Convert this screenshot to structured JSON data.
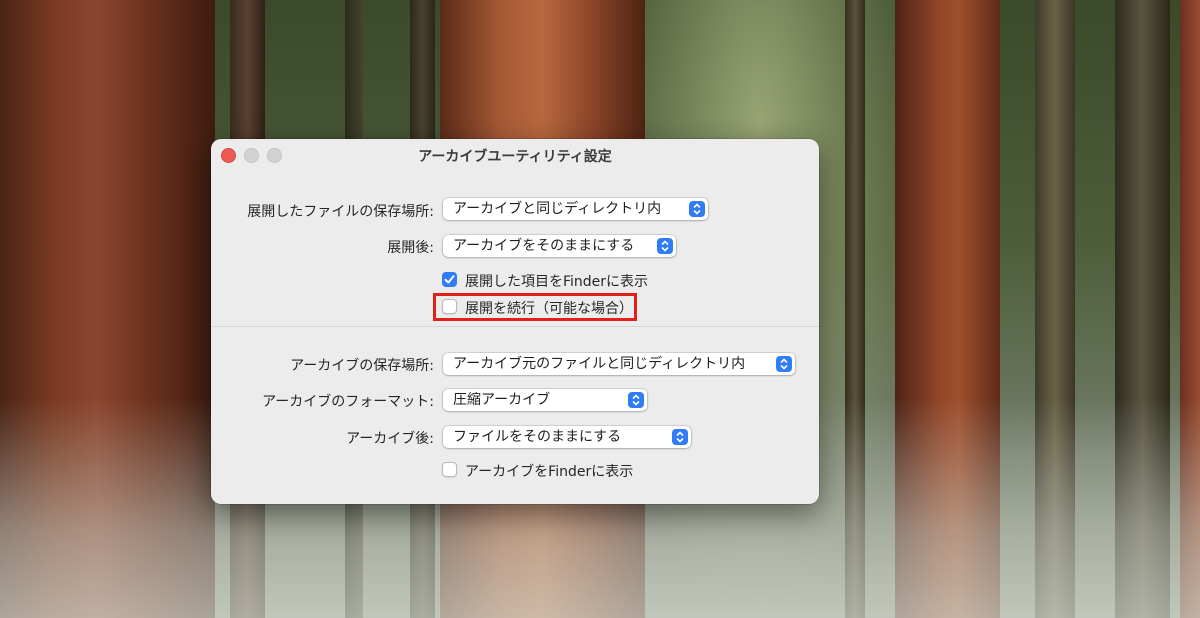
{
  "window": {
    "title": "アーカイブユーティリティ設定"
  },
  "expand": {
    "save_location_label": "展開したファイルの保存場所:",
    "save_location_value": "アーカイブと同じディレクトリ内",
    "after_label": "展開後:",
    "after_value": "アーカイブをそのままにする",
    "reveal_label": "展開した項目をFinderに表示",
    "reveal_checked": true,
    "continue_label": "展開を続行（可能な場合）",
    "continue_checked": false
  },
  "archive": {
    "save_location_label": "アーカイブの保存場所:",
    "save_location_value": "アーカイブ元のファイルと同じディレクトリ内",
    "format_label": "アーカイブのフォーマット:",
    "format_value": "圧縮アーカイブ",
    "after_label": "アーカイブ後:",
    "after_value": "ファイルをそのままにする",
    "reveal_label": "アーカイブをFinderに表示",
    "reveal_checked": false
  },
  "colors": {
    "accent": "#2f7cf6",
    "highlight": "#e1201c",
    "close": "#ee5b53"
  }
}
